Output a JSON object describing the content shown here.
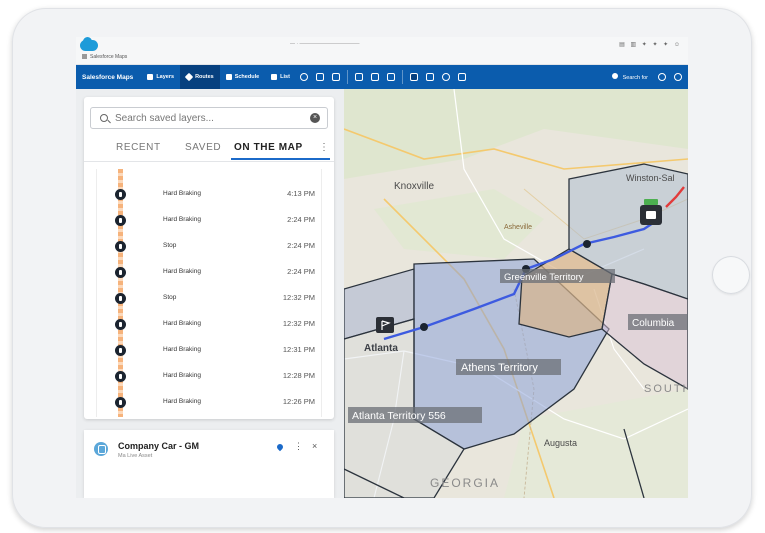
{
  "browser": {
    "tab_title": "Salesforce Maps"
  },
  "nav": {
    "brand": "Salesforce Maps",
    "items": [
      {
        "label": "Layers",
        "icon": "layers-icon"
      },
      {
        "label": "Routes",
        "icon": "route-icon"
      },
      {
        "label": "Schedule",
        "icon": "calendar-icon"
      },
      {
        "label": "List",
        "icon": "list-icon"
      }
    ],
    "search_label": "Search for"
  },
  "panel": {
    "search_placeholder": "Search saved layers...",
    "tabs": [
      "RECENT",
      "SAVED",
      "ON THE MAP"
    ],
    "events": [
      {
        "label": "Hard Braking",
        "time": "4:13 PM"
      },
      {
        "label": "Hard Braking",
        "time": "2:24 PM"
      },
      {
        "label": "Stop",
        "time": "2:24 PM"
      },
      {
        "label": "Hard Braking",
        "time": "2:24 PM"
      },
      {
        "label": "Stop",
        "time": "12:32 PM"
      },
      {
        "label": "Hard Braking",
        "time": "12:32 PM"
      },
      {
        "label": "Hard Braking",
        "time": "12:31 PM"
      },
      {
        "label": "Hard Braking",
        "time": "12:28 PM"
      },
      {
        "label": "Hard Braking",
        "time": "12:26 PM"
      }
    ],
    "vehicle": {
      "name": "Company Car - GM",
      "subtitle": "Ma Live Asset"
    }
  },
  "map": {
    "labels": {
      "knoxville": "Knoxville",
      "winston": "Winston-Sal",
      "asheville": "Asheville",
      "greenville_territory": "Greenville Territory",
      "atlanta_territory": "Athens Territory",
      "atlanta": "Atlanta",
      "atlanta_territory_556": "Atlanta Territory 556",
      "columbia": "Columbia",
      "augusta": "Augusta",
      "georgia": "GEORGIA",
      "south_carolina": "SOUTH CARO"
    },
    "colors": {
      "route": "#3d5be0",
      "territory_fill": "#8da2d9",
      "greenville_fill": "#d9b48a",
      "territory_edge": "#2b333d"
    }
  }
}
